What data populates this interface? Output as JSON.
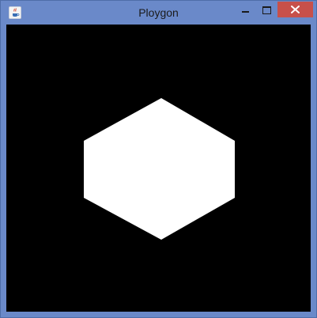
{
  "window": {
    "title": "Ploygon",
    "icon": "java-icon"
  },
  "controls": {
    "minimize_icon": "minimize-icon",
    "maximize_icon": "maximize-icon",
    "close_icon": "close-icon"
  },
  "canvas": {
    "background": "#000000",
    "shape": {
      "type": "hexagon",
      "fill": "#ffffff"
    }
  },
  "colors": {
    "frame": "#6a89c9",
    "close_button": "#c7504a"
  }
}
